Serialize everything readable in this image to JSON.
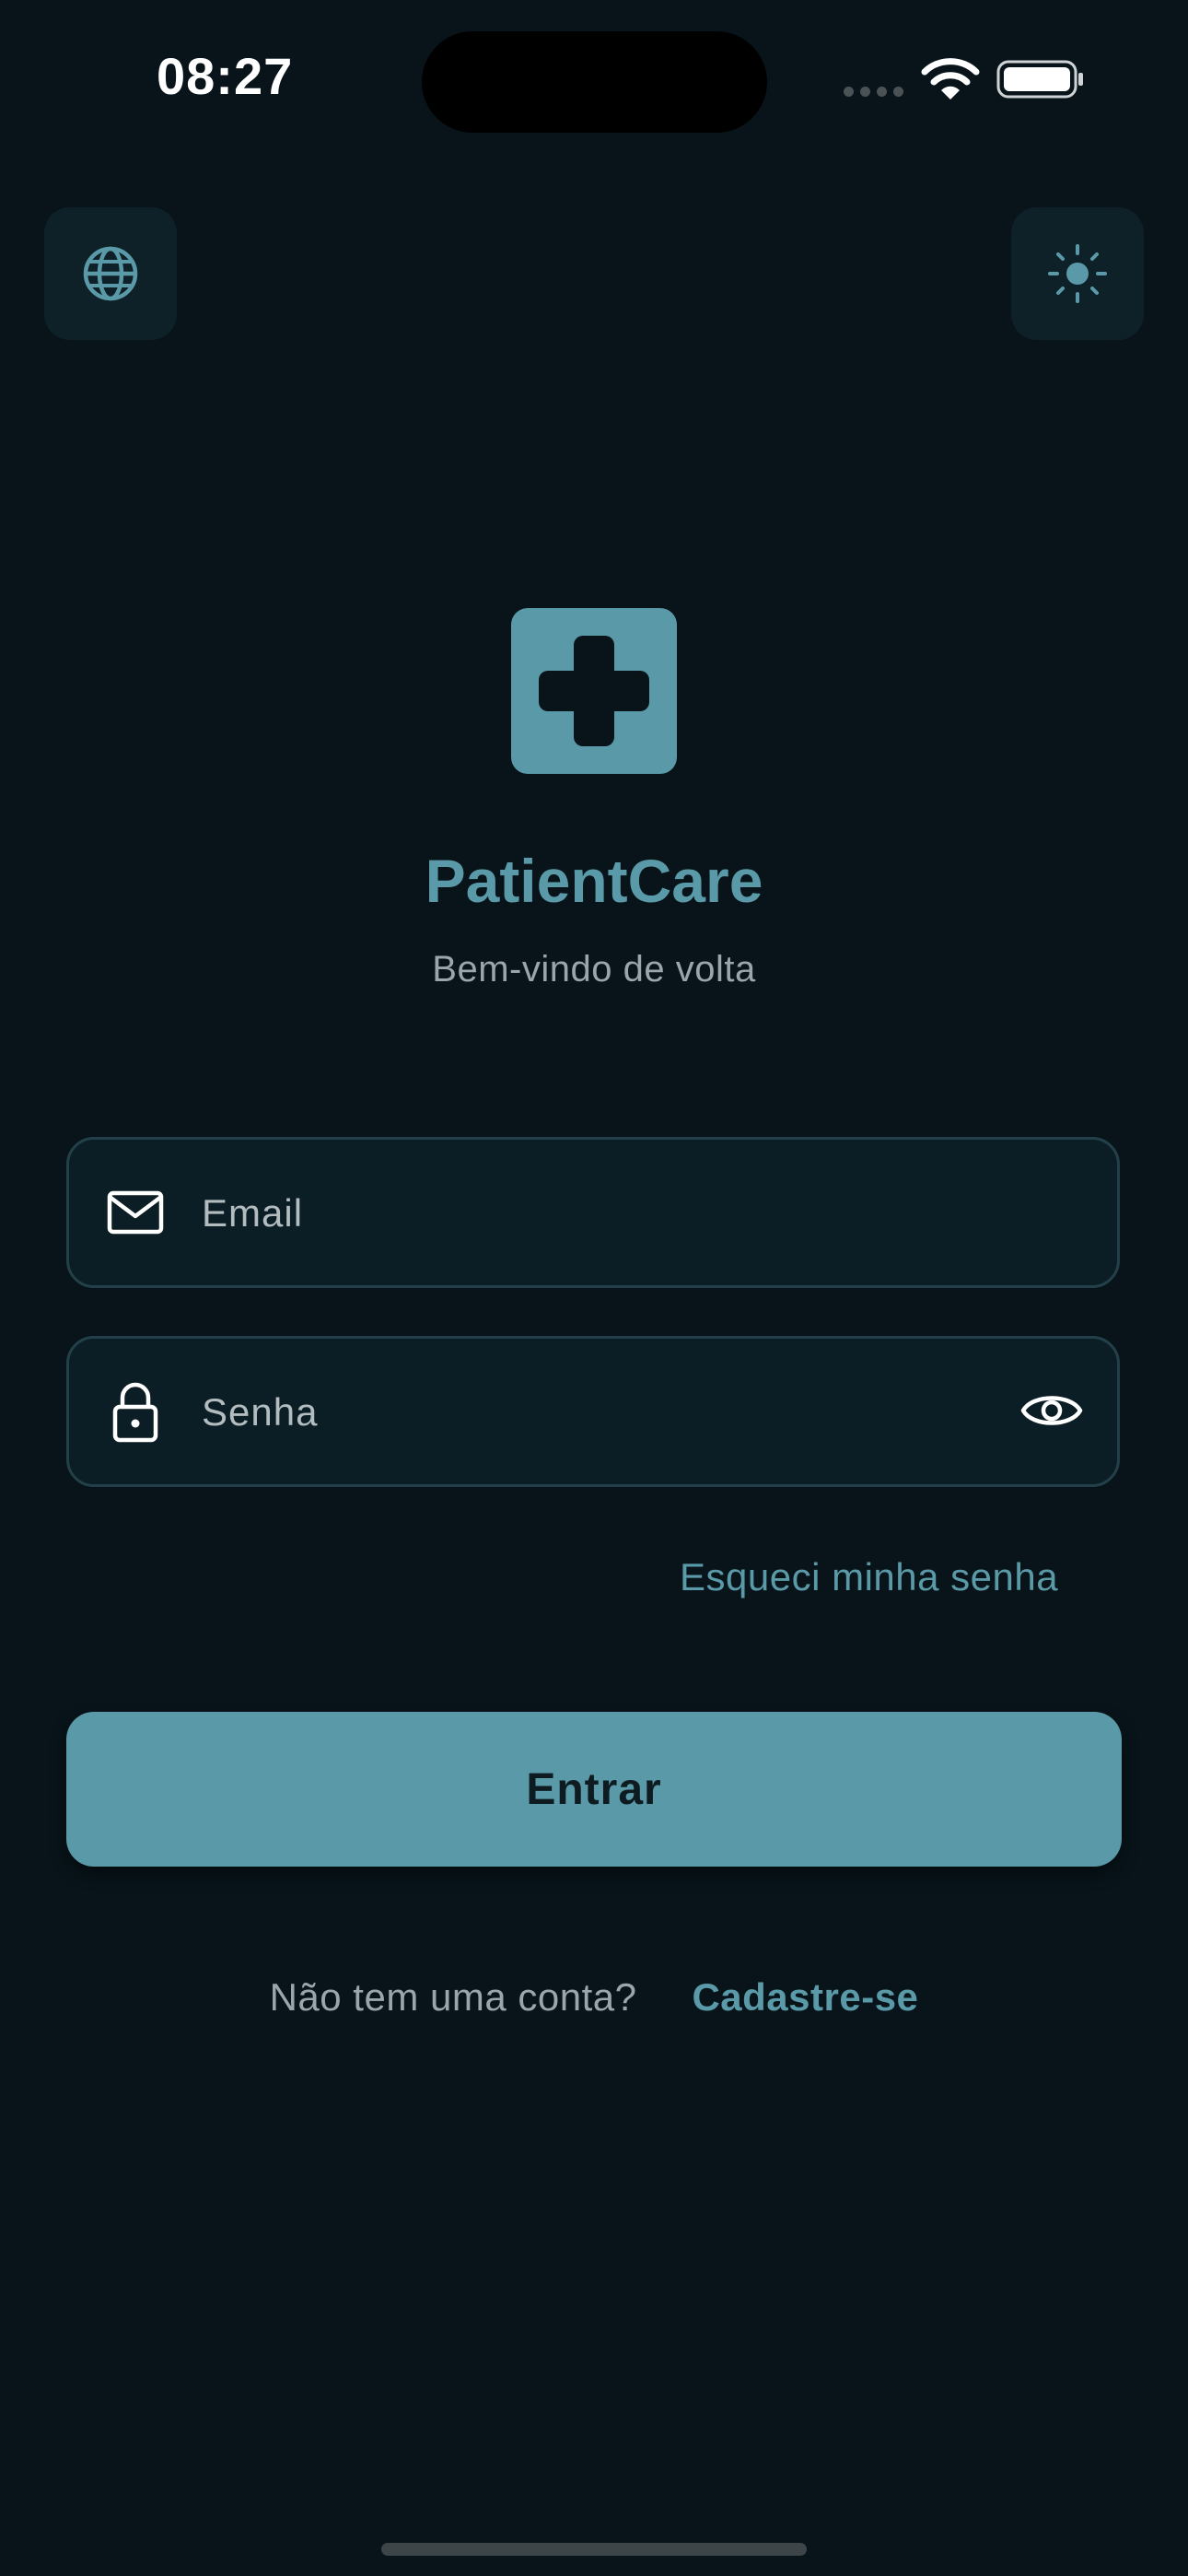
{
  "status_bar": {
    "time": "08:27"
  },
  "header": {
    "language_icon": "globe-icon",
    "theme_icon": "sun-icon"
  },
  "brand": {
    "logo_icon": "medical-cross-icon",
    "title": "PatientCare",
    "subtitle": "Bem-vindo de volta"
  },
  "form": {
    "email": {
      "placeholder": "Email",
      "value": "",
      "icon": "mail-icon"
    },
    "password": {
      "placeholder": "Senha",
      "value": "",
      "icon": "lock-icon",
      "toggle_icon": "eye-icon"
    },
    "forgot_password_label": "Esqueci minha senha",
    "submit_label": "Entrar"
  },
  "signup": {
    "prompt": "Não tem uma conta?",
    "link_label": "Cadastre-se"
  },
  "colors": {
    "background": "#08141a",
    "accent": "#5a9aa8",
    "field_background": "#0b1e25",
    "field_border": "#23404a",
    "muted_text": "#9aa6aa"
  }
}
